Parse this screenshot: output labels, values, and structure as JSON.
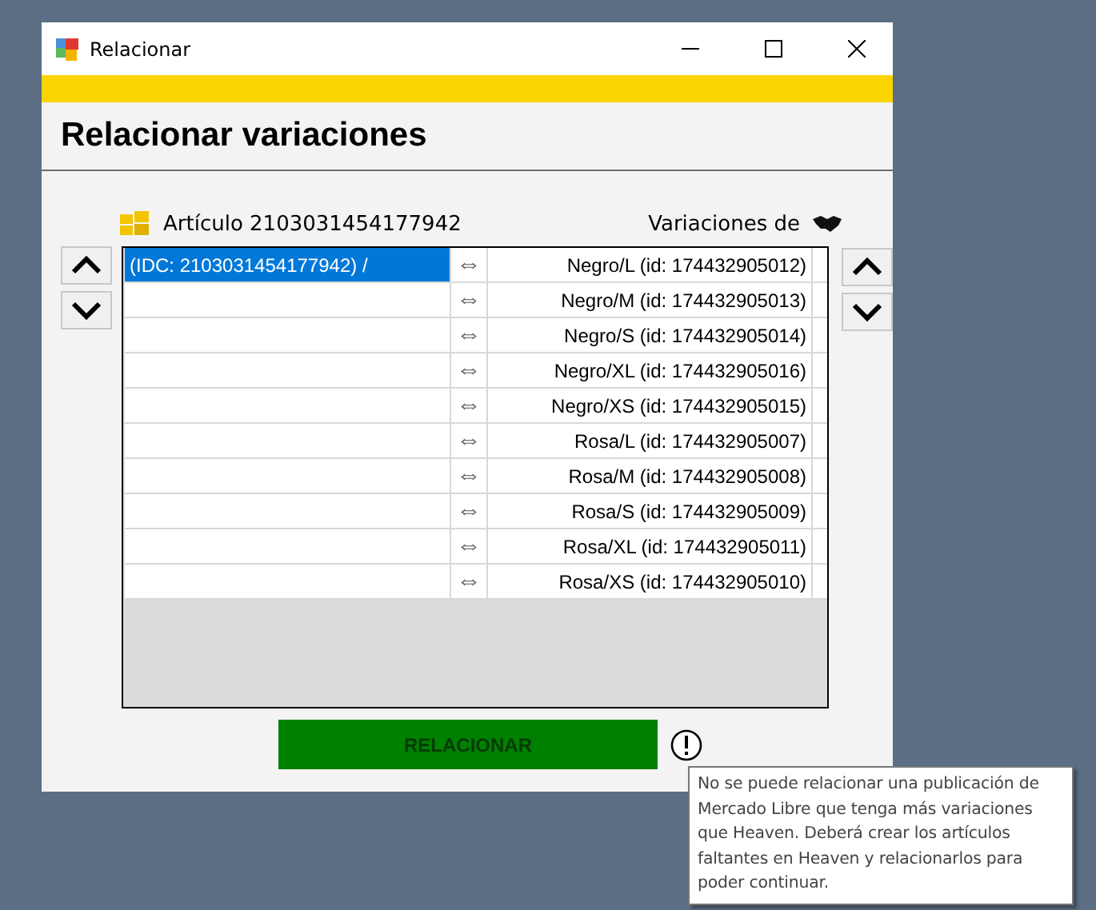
{
  "window": {
    "title": "Relacionar"
  },
  "header": {
    "title": "Relacionar variaciones"
  },
  "article": {
    "label": "Artículo 2103031454177942"
  },
  "variations": {
    "label": "Variaciones de"
  },
  "rows": [
    {
      "left": "(IDC: 2103031454177942) /",
      "selected": true,
      "link": "⇔",
      "right": "Negro/L (id: 174432905012)"
    },
    {
      "left": "",
      "selected": false,
      "link": "⇔",
      "right": "Negro/M (id: 174432905013)"
    },
    {
      "left": "",
      "selected": false,
      "link": "⇔",
      "right": "Negro/S (id: 174432905014)"
    },
    {
      "left": "",
      "selected": false,
      "link": "⇔",
      "right": "Negro/XL (id: 174432905016)"
    },
    {
      "left": "",
      "selected": false,
      "link": "⇔",
      "right": "Negro/XS (id: 174432905015)"
    },
    {
      "left": "",
      "selected": false,
      "link": "⇔",
      "right": "Rosa/L (id: 174432905007)"
    },
    {
      "left": "",
      "selected": false,
      "link": "⇔",
      "right": "Rosa/M (id: 174432905008)"
    },
    {
      "left": "",
      "selected": false,
      "link": "⇔",
      "right": "Rosa/S (id: 174432905009)"
    },
    {
      "left": "",
      "selected": false,
      "link": "⇔",
      "right": "Rosa/XL (id: 174432905011)"
    },
    {
      "left": "",
      "selected": false,
      "link": "⇔",
      "right": "Rosa/XS (id: 174432905010)"
    }
  ],
  "button": {
    "label": "RELACIONAR"
  },
  "tooltip": {
    "text": "No se puede relacionar una publicación de Mercado Libre que tenga más variaciones que Heaven. Deberá crear los artículos faltantes en Heaven y relacionarlos para poder continuar."
  }
}
